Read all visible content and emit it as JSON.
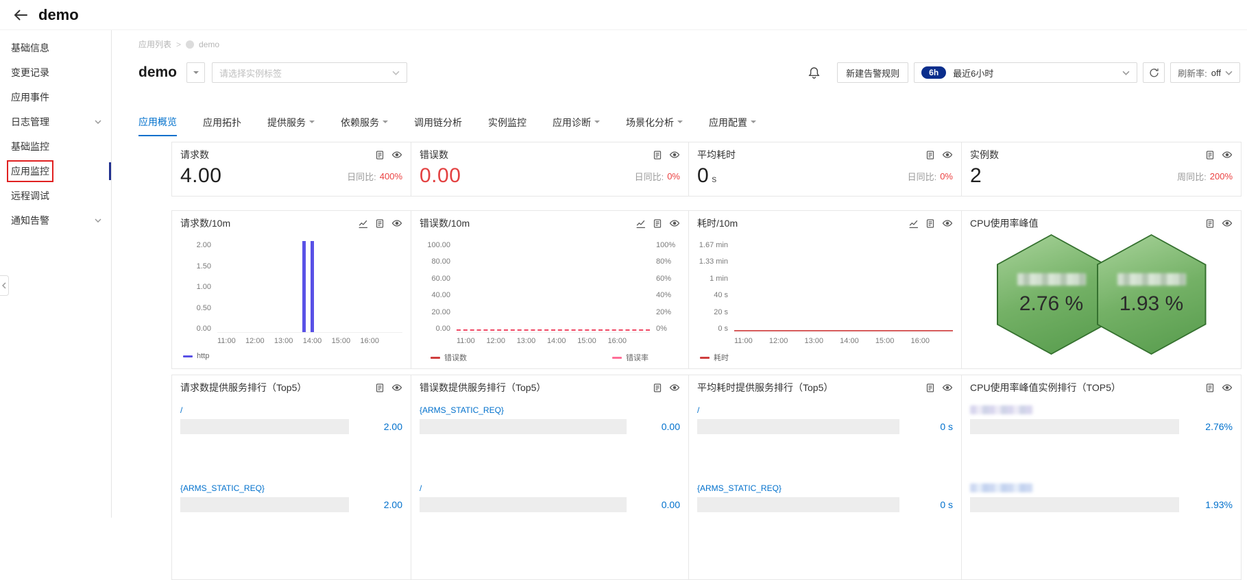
{
  "colors": {
    "accent_blue": "#0070cc",
    "bar_purple": "#5951e6",
    "alert_red": "#eb4141",
    "badge_navy": "#0b2e8c",
    "error_dash_red": "#f04864",
    "error_rate_pink": "#ff6e97",
    "duration_red": "#cf3e3e",
    "hex_green": "#74b166"
  },
  "header": {
    "title": "demo"
  },
  "sidebar": {
    "items": [
      {
        "label": "基础信息",
        "expandable": false
      },
      {
        "label": "变更记录",
        "expandable": false
      },
      {
        "label": "应用事件",
        "expandable": false
      },
      {
        "label": "日志管理",
        "expandable": true
      },
      {
        "label": "基础监控",
        "expandable": false
      },
      {
        "label": "应用监控",
        "expandable": false,
        "selected": true,
        "annotated_red_box": true
      },
      {
        "label": "远程调试",
        "expandable": false
      },
      {
        "label": "通知告警",
        "expandable": true
      }
    ]
  },
  "breadcrumb": {
    "root": "应用列表",
    "separator": ">",
    "current": "demo"
  },
  "toolbar": {
    "title": "demo",
    "tag_select_placeholder": "请选择实例标签",
    "new_alarm_rule": "新建告警规则",
    "time_badge": "6h",
    "time_label": "最近6小时",
    "refresh_rate_label": "刷新率:",
    "refresh_rate_value": "off"
  },
  "tabs": [
    {
      "label": "应用概览",
      "active": true,
      "has_menu": false
    },
    {
      "label": "应用拓扑",
      "active": false,
      "has_menu": false
    },
    {
      "label": "提供服务",
      "active": false,
      "has_menu": true
    },
    {
      "label": "依赖服务",
      "active": false,
      "has_menu": true
    },
    {
      "label": "调用链分析",
      "active": false,
      "has_menu": false
    },
    {
      "label": "实例监控",
      "active": false,
      "has_menu": false
    },
    {
      "label": "应用诊断",
      "active": false,
      "has_menu": true
    },
    {
      "label": "场景化分析",
      "active": false,
      "has_menu": true
    },
    {
      "label": "应用配置",
      "active": false,
      "has_menu": true
    }
  ],
  "kpis": [
    {
      "title": "请求数",
      "value": "4.00",
      "unit": "",
      "compare_label": "日同比:",
      "compare_value": "400%"
    },
    {
      "title": "错误数",
      "value": "0.00",
      "unit": "",
      "compare_label": "日同比:",
      "compare_value": "0%"
    },
    {
      "title": "平均耗时",
      "value": "0",
      "unit": "s",
      "compare_label": "日同比:",
      "compare_value": "0%"
    },
    {
      "title": "实例数",
      "value": "2",
      "unit": "",
      "compare_label": "周同比:",
      "compare_value": "200%"
    }
  ],
  "charts": {
    "requests": {
      "title": "请求数/10m",
      "y_ticks": [
        "2.00",
        "1.50",
        "1.00",
        "0.50",
        "0.00"
      ],
      "x_ticks": [
        "11:00",
        "12:00",
        "13:00",
        "14:00",
        "15:00",
        "16:00"
      ],
      "legend": "http",
      "bars": [
        {
          "left": "46%"
        },
        {
          "left": "50.5%"
        }
      ]
    },
    "errors": {
      "title": "错误数/10m",
      "y_ticks_left": [
        "100.00",
        "80.00",
        "60.00",
        "40.00",
        "20.00",
        "0.00"
      ],
      "y_ticks_right": [
        "100%",
        "80%",
        "60%",
        "40%",
        "20%",
        "0%"
      ],
      "x_ticks": [
        "11:00",
        "12:00",
        "13:00",
        "14:00",
        "15:00",
        "16:00"
      ],
      "legend_count": "错误数",
      "legend_rate": "错误率"
    },
    "duration": {
      "title": "耗时/10m",
      "y_ticks": [
        "1.67 min",
        "1.33 min",
        "1 min",
        "40 s",
        "20 s",
        "0 s"
      ],
      "x_ticks": [
        "11:00",
        "12:00",
        "13:00",
        "14:00",
        "15:00",
        "16:00"
      ],
      "legend": "耗时"
    },
    "cpu": {
      "title": "CPU使用率峰值",
      "values": [
        "2.76 %",
        "1.93 %"
      ],
      "labels_redacted": true
    }
  },
  "chart_data": [
    {
      "type": "bar",
      "title": "请求数/10m",
      "ylim": [
        0,
        2
      ],
      "x_range": [
        "11:00",
        "16:00"
      ],
      "series": [
        {
          "name": "http",
          "points": [
            {
              "x": "≈14:00",
              "y": 2
            },
            {
              "x": "≈14:10",
              "y": 2
            }
          ]
        }
      ]
    },
    {
      "type": "line",
      "title": "错误数/10m",
      "ylim_left": [
        0,
        100
      ],
      "ylim_right_pct": [
        0,
        100
      ],
      "x_range": [
        "11:00",
        "16:00"
      ],
      "series": [
        {
          "name": "错误数",
          "constant": 0
        },
        {
          "name": "错误率",
          "constant": 0
        }
      ]
    },
    {
      "type": "line",
      "title": "耗时/10m",
      "ylim": [
        "0 s",
        "1.67 min"
      ],
      "x_range": [
        "11:00",
        "16:00"
      ],
      "series": [
        {
          "name": "耗时",
          "constant": 0
        }
      ]
    },
    {
      "type": "stat-hexagon",
      "title": "CPU使用率峰值",
      "values": [
        "2.76 %",
        "1.93 %"
      ]
    }
  ],
  "top5": [
    {
      "title": "请求数提供服务排行（Top5）",
      "items": [
        {
          "label": "/",
          "value": "2.00",
          "fill": "100%"
        },
        {
          "label": "{ARMS_STATIC_REQ}",
          "value": "2.00",
          "fill": "100%"
        }
      ]
    },
    {
      "title": "错误数提供服务排行（Top5）",
      "items": [
        {
          "label": "{ARMS_STATIC_REQ}",
          "value": "0.00",
          "fill": "0%"
        },
        {
          "label": "/",
          "value": "0.00",
          "fill": "0%"
        }
      ]
    },
    {
      "title": "平均耗时提供服务排行（Top5）",
      "items": [
        {
          "label": "/",
          "value": "0 s",
          "fill": "0%"
        },
        {
          "label": "{ARMS_STATIC_REQ}",
          "value": "0 s",
          "fill": "0%"
        }
      ]
    },
    {
      "title": "CPU使用率峰值实例排行（TOP5）",
      "items": [
        {
          "label": "",
          "redacted": true,
          "value": "2.76%",
          "fill": "2.76%"
        },
        {
          "label": "",
          "redacted": true,
          "value": "1.93%",
          "fill": "1.93%"
        }
      ]
    }
  ]
}
